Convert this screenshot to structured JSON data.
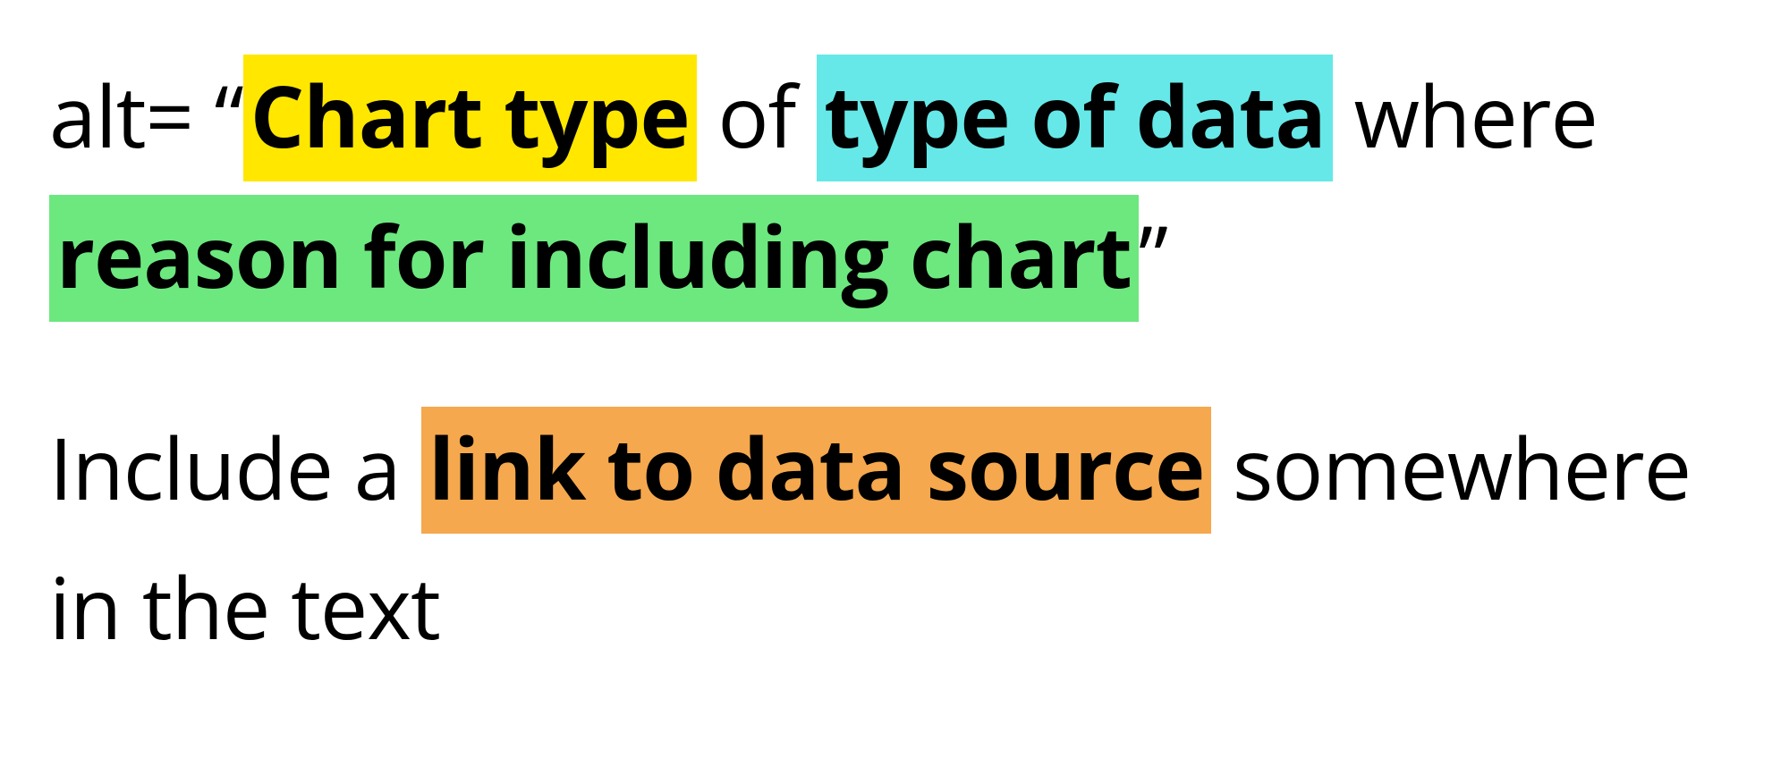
{
  "paragraph1": {
    "prefix": "alt= “",
    "chart_type": "Chart type",
    "of": " of ",
    "type_of_data": "type of data",
    "where": " where ",
    "reason": "reason for including chart",
    "suffix": "”"
  },
  "paragraph2": {
    "prefix": "Include a ",
    "link": "link to data source",
    "suffix": " somewhere in the text"
  },
  "colors": {
    "yellow": "#ffe700",
    "cyan": "#66e8e8",
    "green": "#6ce87f",
    "orange": "#f5a84d"
  }
}
